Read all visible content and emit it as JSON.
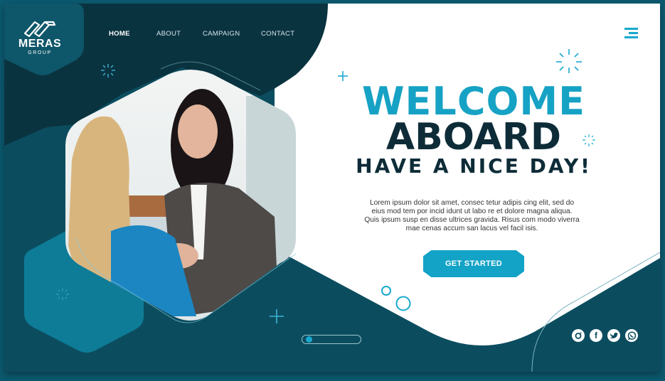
{
  "brand": {
    "name": "MERAS",
    "sub": "GROUP"
  },
  "nav": {
    "items": [
      {
        "label": "HOME",
        "active": true
      },
      {
        "label": "ABOUT",
        "active": false
      },
      {
        "label": "CAMPAIGN",
        "active": false
      },
      {
        "label": "CONTACT",
        "active": false
      }
    ]
  },
  "hero": {
    "title_line1": "WELCOME",
    "title_line2": "ABOARD",
    "subtitle": "HAVE A NICE DAY!",
    "paragraph": "Lorem ipsum dolor sit amet, consec tetur adipis cing elit, sed do eius mod tem por incid idunt ut labo re et dolore magna aliqua. Quis ipsum susp en disse ultrices gravida. Risus com modo viverra mae cenas accum san lacus vel facil isis.",
    "cta_label": "GET STARTED"
  },
  "slider": {
    "position_fraction": 0.05
  },
  "social": [
    {
      "icon": "instagram-icon",
      "glyph": "o"
    },
    {
      "icon": "facebook-icon",
      "glyph": "f"
    },
    {
      "icon": "twitter-icon",
      "glyph": "t"
    },
    {
      "icon": "whatsapp-icon",
      "glyph": "w"
    }
  ],
  "colors": {
    "accent": "#16a2c4",
    "dark": "#0d2c38",
    "panel": "#0b4d5f",
    "navy": "#0a3340"
  }
}
